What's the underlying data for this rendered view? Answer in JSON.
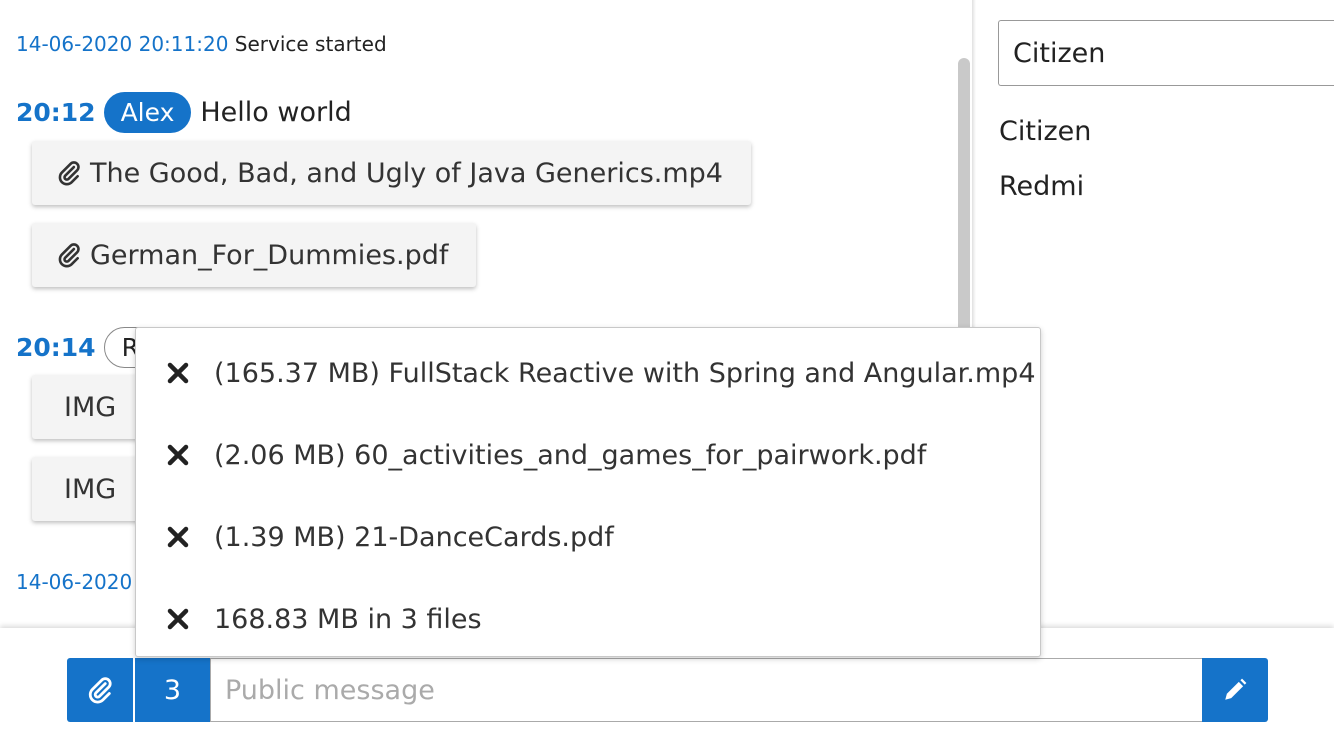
{
  "chat": {
    "system_top": {
      "timestamp": "14-06-2020 20:11:20",
      "text": "Service started"
    },
    "messages": [
      {
        "time": "20:12",
        "user": "Alex",
        "text": "Hello world",
        "attachments": [
          "The Good, Bad, and Ugly of Java Generics.mp4",
          "German_For_Dummies.pdf"
        ]
      },
      {
        "time": "20:14",
        "user": "Re",
        "attachments": [
          "IMG",
          "IMG"
        ]
      }
    ],
    "system_bottom": {
      "timestamp": "14-06-2020"
    }
  },
  "sidebar": {
    "search_value": "Citizen",
    "users": [
      "Citizen",
      "Redmi"
    ]
  },
  "upload_popup": {
    "items": [
      "(165.37 MB) FullStack Reactive with Spring and Angular.mp4",
      "(2.06 MB) 60_activities_and_games_for_pairwork.pdf",
      "(1.39 MB) 21-DanceCards.pdf",
      "168.83 MB in 3 files"
    ]
  },
  "composer": {
    "file_count": "3",
    "placeholder": "Public message"
  },
  "colors": {
    "accent": "#1573c9"
  },
  "icons": {
    "attach": "paperclip-icon",
    "menu": "hamburger-icon",
    "send": "pencil-icon",
    "remove": "close-icon"
  }
}
